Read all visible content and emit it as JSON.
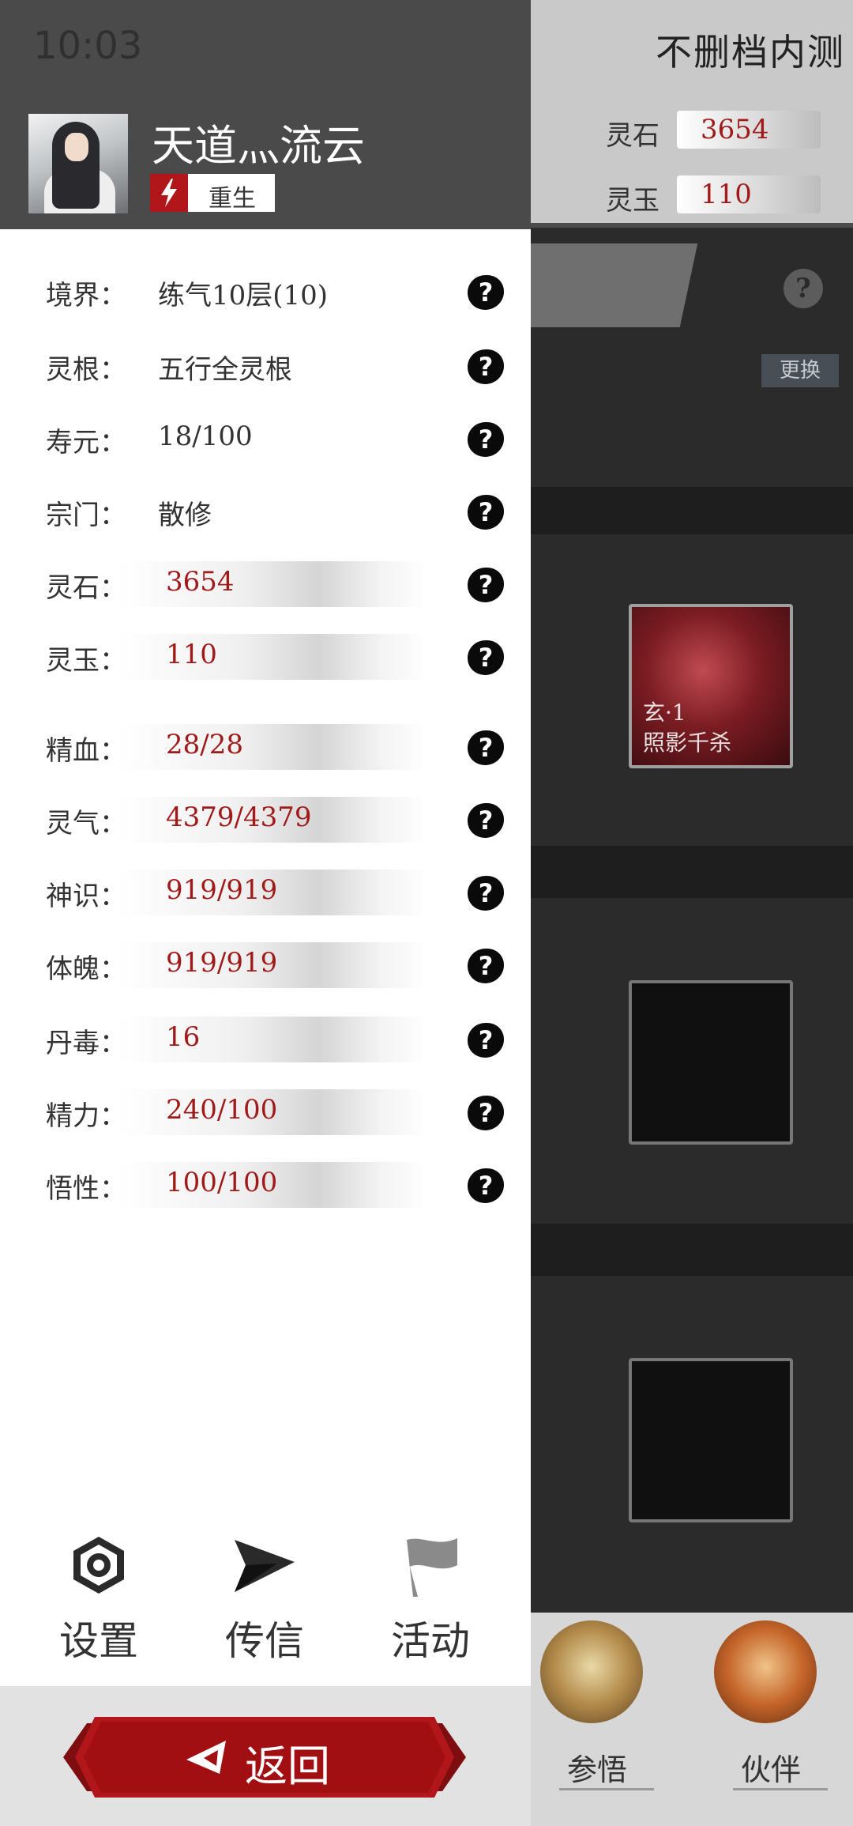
{
  "status_bar": {
    "time": "10:03"
  },
  "game": {
    "title": "不删档内测",
    "resources": [
      {
        "label": "灵石",
        "value": "3654"
      },
      {
        "label": "灵玉",
        "value": "110"
      }
    ],
    "help_icon": "?",
    "change_button": "更换",
    "skill_slots": [
      {
        "tier": "玄·1",
        "name": "照影千杀"
      },
      {
        "tier": "",
        "name": ""
      },
      {
        "tier": "",
        "name": ""
      }
    ],
    "bottom_nav": [
      {
        "label": "参悟",
        "icon": "scroll-icon"
      },
      {
        "label": "伙伴",
        "icon": "companion-icon"
      }
    ]
  },
  "profile": {
    "name": "天道灬流云",
    "badge_label": "重生"
  },
  "stats": [
    {
      "label": "境界：",
      "value": "练气10层(10)",
      "bar": false
    },
    {
      "label": "灵根：",
      "value": "五行全灵根",
      "bar": false
    },
    {
      "label": "寿元：",
      "value": "18/100",
      "bar": false
    },
    {
      "label": "宗门：",
      "value": "散修",
      "bar": false
    },
    {
      "label": "灵石：",
      "value": "3654",
      "bar": true
    },
    {
      "label": "灵玉：",
      "value": "110",
      "bar": true
    },
    {
      "label": "精血：",
      "value": "28/28",
      "bar": true
    },
    {
      "label": "灵气：",
      "value": "4379/4379",
      "bar": true
    },
    {
      "label": "神识：",
      "value": "919/919",
      "bar": true
    },
    {
      "label": "体魄：",
      "value": "919/919",
      "bar": true
    },
    {
      "label": "丹毒：",
      "value": "16",
      "bar": true
    },
    {
      "label": "精力：",
      "value": "240/100",
      "bar": true
    },
    {
      "label": "悟性：",
      "value": "100/100",
      "bar": true
    }
  ],
  "menu": {
    "settings": "设置",
    "message": "传信",
    "activity": "活动"
  },
  "back_button": "返回",
  "colors": {
    "accent_red": "#b1161a",
    "value_red": "#a11a1a",
    "header_gray": "#4a4a4a"
  }
}
